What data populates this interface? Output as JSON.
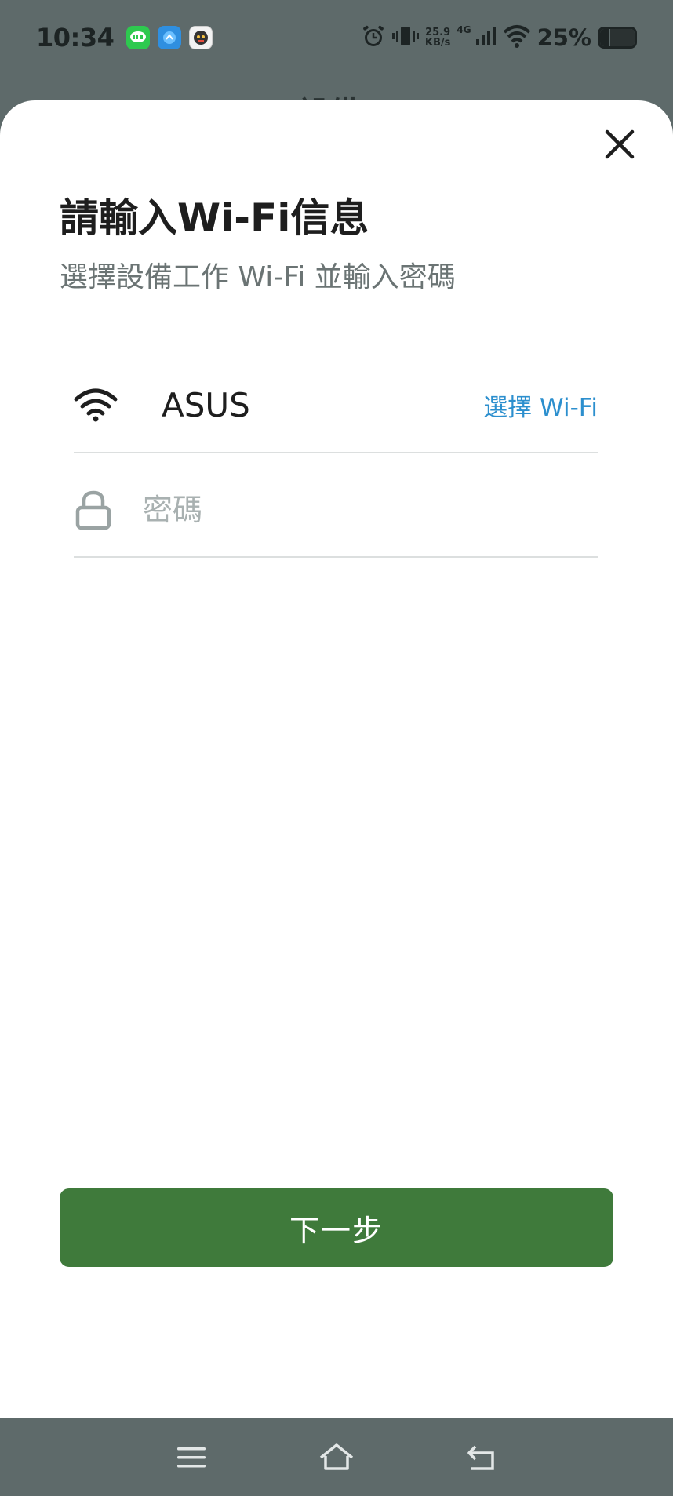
{
  "status_bar": {
    "time": "10:34",
    "speed_value": "25.9",
    "speed_unit": "KB/s",
    "network_type": "4G",
    "battery_percent": "25%",
    "battery_level": 0.25,
    "app_icons": [
      "line-app-icon",
      "messenger-app-icon",
      "game-app-icon"
    ]
  },
  "background_app": {
    "title_partial": "…設備"
  },
  "sheet": {
    "title": "請輸入Wi-Fi信息",
    "subtitle": "選擇設備工作 Wi-Fi 並輸入密碼",
    "wifi_name": "ASUS",
    "choose_wifi_label": "選擇 Wi-Fi",
    "password_placeholder": "密碼",
    "password_value": "",
    "next_button_label": "下一步"
  },
  "colors": {
    "accent_green": "#3f7a3b",
    "link_blue": "#2c8fce",
    "overlay": "#5e6a6a"
  },
  "nav_bar": {
    "buttons": [
      "menu-icon",
      "home-icon",
      "back-icon"
    ]
  }
}
